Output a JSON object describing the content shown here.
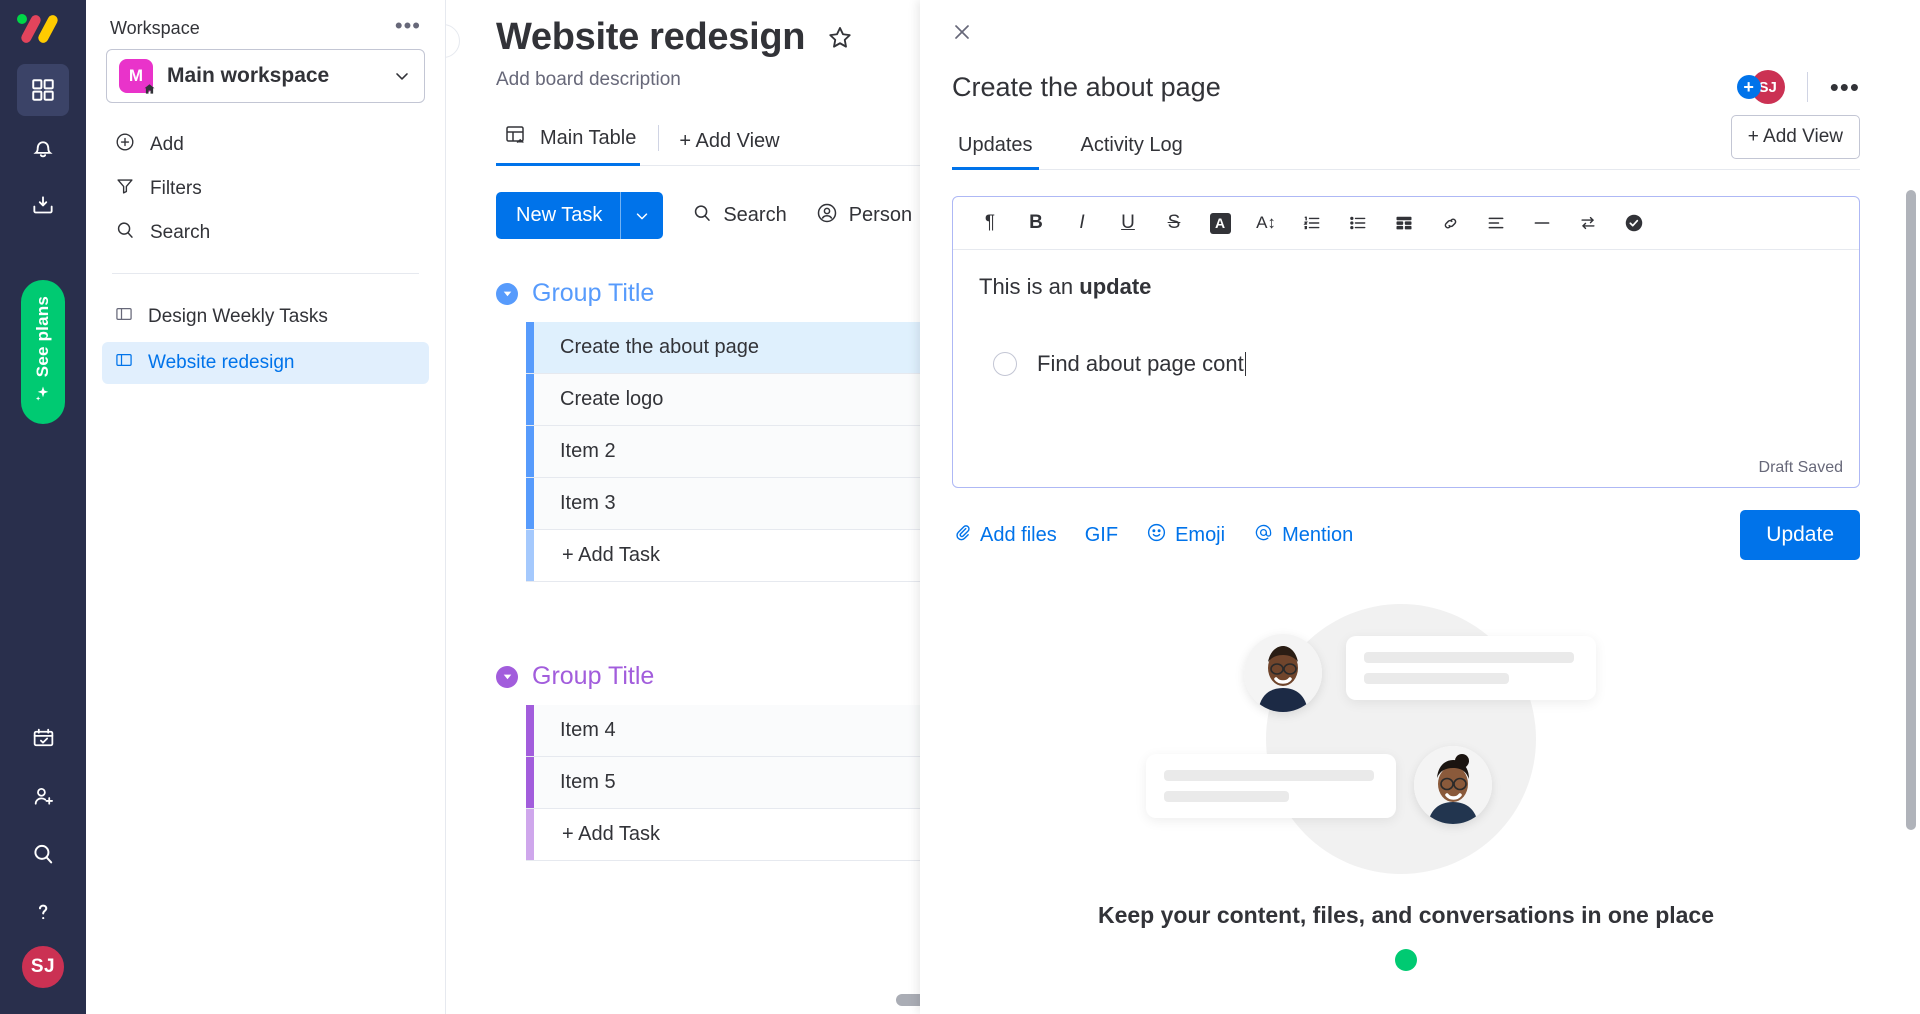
{
  "rail": {
    "logo_alt": "monday-logo",
    "items": [
      {
        "name": "home-grid",
        "icon": "grid-icon",
        "active": true
      },
      {
        "name": "notifications",
        "icon": "bell-icon",
        "active": false
      },
      {
        "name": "inbox",
        "icon": "inbox-icon",
        "active": false
      }
    ],
    "see_plans_label": "See plans",
    "bottom_items": [
      {
        "name": "my-work",
        "icon": "calendar-check-icon"
      },
      {
        "name": "invite-members",
        "icon": "person-add-icon"
      },
      {
        "name": "search-everything",
        "icon": "search-icon"
      },
      {
        "name": "help",
        "icon": "question-mark-icon"
      }
    ],
    "avatar_initials": "SJ"
  },
  "sidebar": {
    "workspace_label": "Workspace",
    "more_options": "•••",
    "workspace_name": "Main workspace",
    "workspace_initial": "M",
    "actions": [
      {
        "label": "Add",
        "icon": "plus-circle-icon"
      },
      {
        "label": "Filters",
        "icon": "filter-icon"
      },
      {
        "label": "Search",
        "icon": "search-icon"
      }
    ],
    "boards": [
      {
        "label": "Design Weekly Tasks",
        "selected": false
      },
      {
        "label": "Website redesign",
        "selected": true
      }
    ]
  },
  "board": {
    "title": "Website redesign",
    "description": "Add board description",
    "tabs": [
      {
        "label": "Main Table",
        "active": true
      },
      {
        "label": "+ Add View",
        "active": false
      }
    ],
    "toolbar": {
      "new_task_label": "New Task",
      "search_label": "Search",
      "person_label": "Person"
    },
    "groups": [
      {
        "title": "Group Title",
        "color": "#579bfc",
        "rows": [
          {
            "name": "Create the about page",
            "selected": true
          },
          {
            "name": "Create logo",
            "selected": false
          },
          {
            "name": "Item 2",
            "selected": false
          },
          {
            "name": "Item 3",
            "selected": false
          }
        ],
        "add_task_label": "+ Add Task"
      },
      {
        "title": "Group Title",
        "color": "#a25ddc",
        "rows": [
          {
            "name": "Item 4",
            "selected": false
          },
          {
            "name": "Item 5",
            "selected": false
          }
        ],
        "add_task_label": "+ Add Task"
      }
    ]
  },
  "panel": {
    "close_icon": "close-icon",
    "title": "Create the about page",
    "add_person_label": "+",
    "avatar_initials": "SJ",
    "more_options": "•••",
    "tabs": [
      {
        "label": "Updates",
        "active": true
      },
      {
        "label": "Activity Log",
        "active": false
      }
    ],
    "add_view_label": "+ Add View",
    "editor": {
      "toolbar": [
        {
          "name": "paragraph",
          "glyph": "¶"
        },
        {
          "name": "bold",
          "glyph": "B"
        },
        {
          "name": "italic",
          "glyph": "I"
        },
        {
          "name": "underline",
          "glyph": "U"
        },
        {
          "name": "strikethrough",
          "glyph": "S"
        },
        {
          "name": "text-color",
          "glyph": "A"
        },
        {
          "name": "font-size",
          "glyph": "A↕"
        },
        {
          "name": "numbered-list",
          "glyph": ""
        },
        {
          "name": "bulleted-list",
          "glyph": ""
        },
        {
          "name": "table",
          "glyph": ""
        },
        {
          "name": "link",
          "glyph": ""
        },
        {
          "name": "align",
          "glyph": ""
        },
        {
          "name": "horizontal-rule",
          "glyph": ""
        },
        {
          "name": "indent",
          "glyph": ""
        },
        {
          "name": "checklist",
          "glyph": ""
        }
      ],
      "line1_prefix": "This is an ",
      "line1_bold": "update",
      "checklist_text": "Find about page cont",
      "draft_status": "Draft Saved"
    },
    "actions": [
      {
        "label": "Add files",
        "icon": "paperclip-icon"
      },
      {
        "label": "GIF",
        "icon": "gif-icon"
      },
      {
        "label": "Emoji",
        "icon": "smiley-icon"
      },
      {
        "label": "Mention",
        "icon": "at-icon"
      }
    ],
    "update_button": "Update",
    "empty_state_title": "Keep your content, files, and conversations in one place"
  },
  "colors": {
    "primary": "#0073ea",
    "rail_bg": "#292f4c",
    "accent_green": "#00ca72",
    "group1": "#579bfc",
    "group2": "#a25ddc",
    "avatar_red": "#cb3153",
    "workspace_magenta": "#e933ca"
  }
}
